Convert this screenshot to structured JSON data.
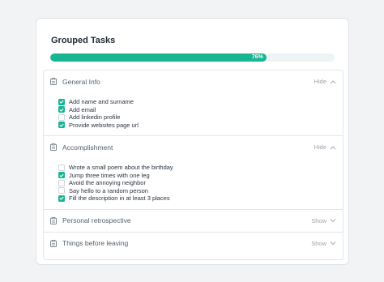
{
  "card": {
    "title": "Grouped Tasks",
    "progress_label": "76%",
    "progress_value": 0.76
  },
  "colors": {
    "accent": "#18b592",
    "track": "#eef3f6",
    "muted_text": "#9aa3ac"
  },
  "groups": [
    {
      "title": "General Info",
      "toggle_label": "Hide",
      "expanded": true,
      "tasks": [
        {
          "label": "Add name and surname",
          "checked": true
        },
        {
          "label": "Add email",
          "checked": true
        },
        {
          "label": "Add linkedin profile",
          "checked": false
        },
        {
          "label": "Provide websites page url",
          "checked": true
        }
      ]
    },
    {
      "title": "Accomplishment",
      "toggle_label": "Hide",
      "expanded": true,
      "tasks": [
        {
          "label": "Wrote a small poem about the birthday",
          "checked": false
        },
        {
          "label": "Jump three times with one leg",
          "checked": true
        },
        {
          "label": "Avoid the annoying neighbor",
          "checked": false
        },
        {
          "label": "Say hello to a random person",
          "checked": false
        },
        {
          "label": "Fill the description in at least 3 places",
          "checked": true
        }
      ]
    },
    {
      "title": "Personal retrospective",
      "toggle_label": "Show",
      "expanded": false,
      "tasks": []
    },
    {
      "title": "Things before leaving",
      "toggle_label": "Show",
      "expanded": false,
      "tasks": []
    }
  ]
}
